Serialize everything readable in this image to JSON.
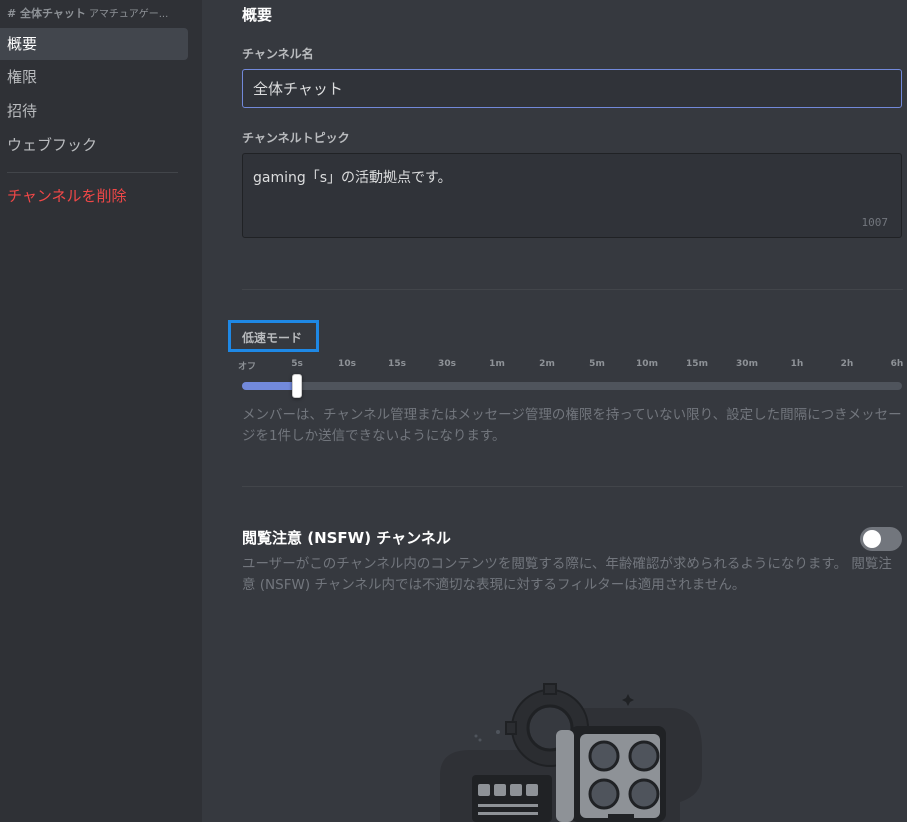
{
  "sidebar": {
    "header_channel": "# 全体チャット",
    "header_category": "アマチュアゲー...",
    "items": [
      {
        "label": "概要",
        "selected": true
      },
      {
        "label": "権限",
        "selected": false
      },
      {
        "label": "招待",
        "selected": false
      },
      {
        "label": "ウェブフック",
        "selected": false
      }
    ],
    "delete_label": "チャンネルを削除"
  },
  "main": {
    "title": "概要",
    "channel_name_label": "チャンネル名",
    "channel_name_value": "全体チャット",
    "topic_label": "チャンネルトピック",
    "topic_value": "gaming「s」の活動拠点です。",
    "topic_remaining": "1007",
    "slowmode": {
      "label": "低速モード",
      "ticks": [
        "オフ",
        "5s",
        "10s",
        "15s",
        "30s",
        "1m",
        "2m",
        "5m",
        "10m",
        "15m",
        "30m",
        "1h",
        "2h",
        "6h"
      ],
      "selected_index": 1,
      "description": "メンバーは、チャンネル管理またはメッセージ管理の権限を持っていない限り、設定した間隔につきメッセージを1件しか送信できないようになります。"
    },
    "nsfw": {
      "title": "閲覧注意 (NSFW) チャンネル",
      "enabled": false,
      "description": "ユーザーがこのチャンネル内のコンテンツを閲覧する際に、年齢確認が求められるようになります。 閲覧注意 (NSFW) チャンネル内では不適切な表現に対するフィルターは適用されません。"
    }
  },
  "colors": {
    "accent": "#7289da",
    "danger": "#f04747",
    "highlight_box": "#1e88e5"
  }
}
